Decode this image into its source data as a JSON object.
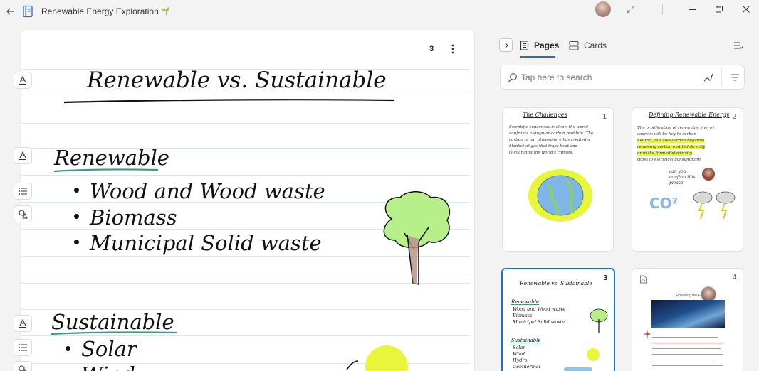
{
  "window": {
    "title": "Renewable Energy Exploration",
    "title_emoji": "🌱"
  },
  "page": {
    "page_count": "3",
    "title": "Renewable vs. Sustainable",
    "section1_heading": "Renewable",
    "section1_items": [
      "Wood   and  Wood waste",
      "Biomass",
      "Municipal  Solid waste"
    ],
    "section2_heading": "Sustainable",
    "section2_items": [
      "Solar",
      "Wind"
    ]
  },
  "sidebar": {
    "tabs": [
      {
        "label": "Pages",
        "icon": "pages-icon",
        "selected": true
      },
      {
        "label": "Cards",
        "icon": "cards-icon",
        "selected": false
      }
    ],
    "search": {
      "placeholder": "Tap here to search"
    },
    "thumbnails": [
      {
        "number": "1",
        "title": "The Challenges",
        "lines": [
          "Scientific consensus is clear: the world",
          "confronts a singular carbon problem. The",
          "carbon in our atmosphere has created a",
          "blanket of gas that traps heat and",
          "is changing the world's climate."
        ]
      },
      {
        "number": "2",
        "title": "Defining Renewable Energy",
        "lines": [
          "The proliferation of renewable energy",
          "sources will be key to carbon",
          "neutral, but also carbon negative",
          "removing carbon emitted directly",
          "or in the form of electricity",
          "types of electrical consumption"
        ],
        "note": "can you confirm this please",
        "co2": "CO²"
      },
      {
        "number": "3",
        "title": "Renewable vs. Sustainable",
        "section1_heading": "Renewable",
        "section1_items": [
          "Wood  and  Wood waste",
          "Biomass",
          "Municipal  Solid waste"
        ],
        "section2_heading": "Sustainable",
        "section2_items": [
          "Solar",
          "Wind",
          "Hydro",
          "Geothermal"
        ]
      },
      {
        "number": "4",
        "heading": "Powering the Future"
      }
    ]
  },
  "colors": {
    "accent": "#1a73c8",
    "underline_teal": "#3a9a8c",
    "ruled_line": "#d6e7f5",
    "highlighter": "#e8f53a",
    "tree_green": "#b7f08a",
    "globe_blue": "#7fb6e8"
  }
}
